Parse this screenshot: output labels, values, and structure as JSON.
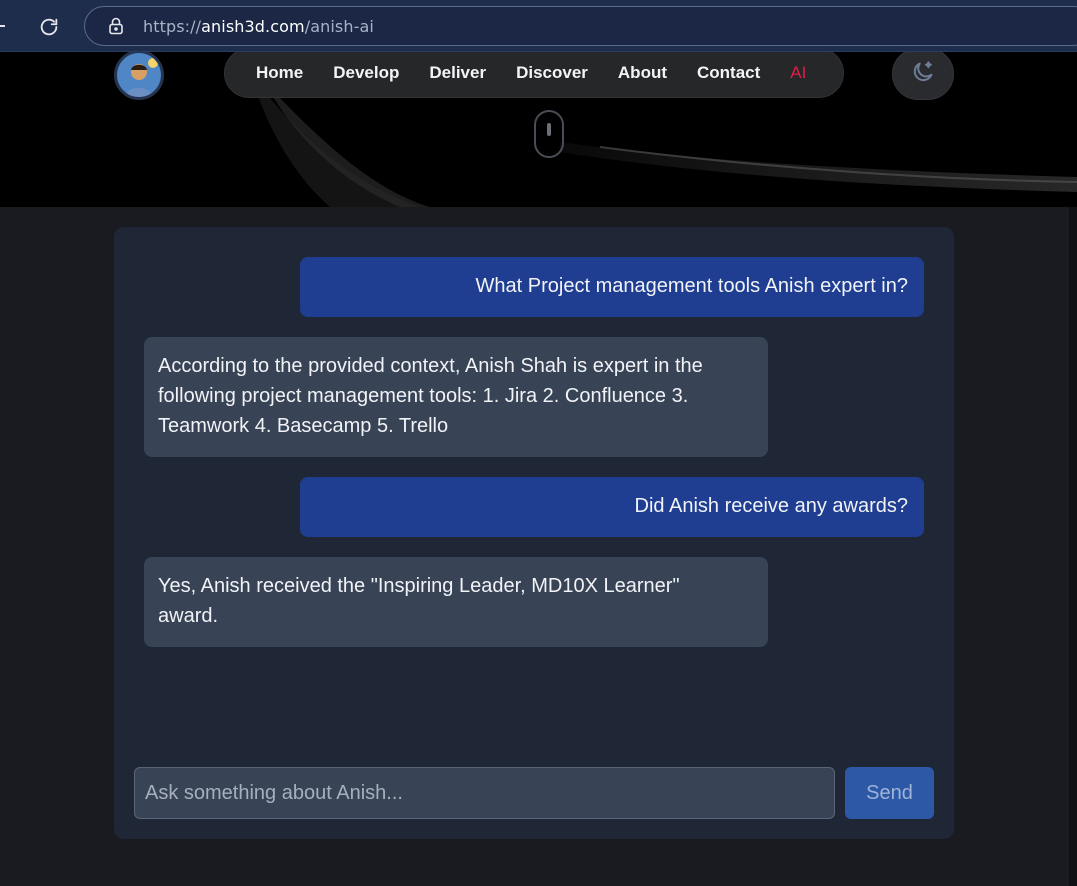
{
  "browser": {
    "url_protocol": "https://",
    "url_host": "anish3d.com",
    "url_path": "/anish-ai"
  },
  "nav": {
    "links": [
      "Home",
      "Develop",
      "Deliver",
      "Discover",
      "About",
      "Contact"
    ],
    "active_link": "AI"
  },
  "chat": {
    "messages": [
      {
        "role": "user",
        "text": "What Project management tools Anish expert in?"
      },
      {
        "role": "assistant",
        "text": "According to the provided context, Anish Shah is expert in the following project management tools: 1. Jira 2. Confluence 3. Teamwork 4. Basecamp 5. Trello"
      },
      {
        "role": "user",
        "text": "Did Anish receive any awards?"
      },
      {
        "role": "assistant",
        "text": "Yes, Anish received the \"Inspiring Leader, MD10X Learner\" award."
      }
    ],
    "input_placeholder": "Ask something about Anish...",
    "send_label": "Send"
  },
  "colors": {
    "user_bubble": "#1f3e92",
    "assistant_bubble": "#384355",
    "panel": "#1f2736",
    "active_nav": "#e11d48"
  },
  "icons": [
    "reload-icon",
    "lock-icon",
    "moon-stars-icon",
    "scroll-mouse-icon"
  ]
}
